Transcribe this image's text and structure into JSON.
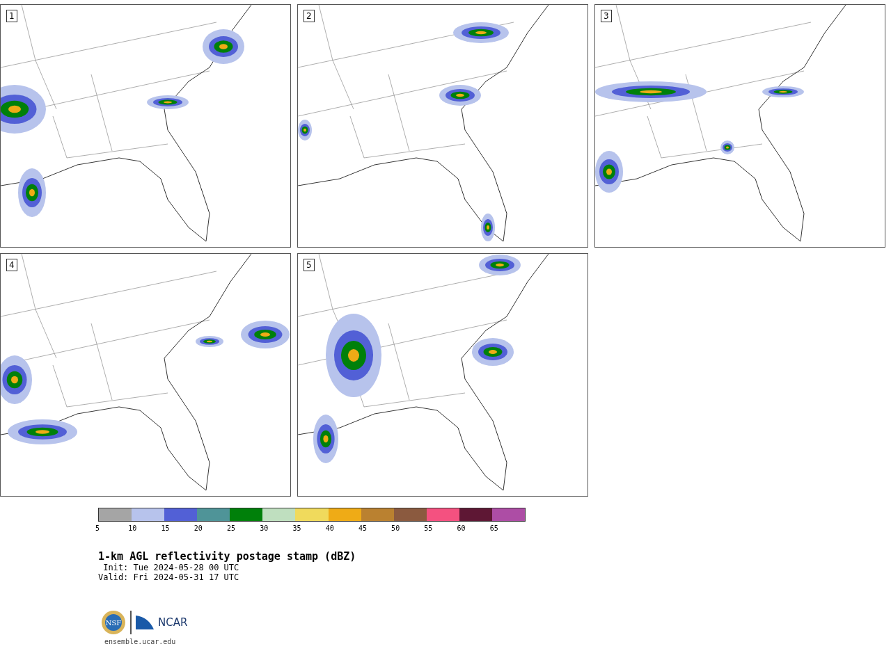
{
  "panels": [
    {
      "number": "1"
    },
    {
      "number": "2"
    },
    {
      "number": "3"
    },
    {
      "number": "4"
    },
    {
      "number": "5"
    }
  ],
  "colorbar": {
    "bins": [
      {
        "label": "5",
        "color": "#a5a5a5"
      },
      {
        "label": "10",
        "color": "#b7c3ec"
      },
      {
        "label": "15",
        "color": "#5260d6"
      },
      {
        "label": "20",
        "color": "#4f9498"
      },
      {
        "label": "25",
        "color": "#00800a"
      },
      {
        "label": "30",
        "color": "#bfdfbf"
      },
      {
        "label": "35",
        "color": "#f0da5c"
      },
      {
        "label": "40",
        "color": "#efab16"
      },
      {
        "label": "45",
        "color": "#ba8130"
      },
      {
        "label": "50",
        "color": "#8b5a3f"
      },
      {
        "label": "55",
        "color": "#f45180"
      },
      {
        "label": "60",
        "color": "#5e1734"
      },
      {
        "label": "65",
        "color": "#ad4da5"
      }
    ]
  },
  "title": "1-km AGL reflectivity postage stamp (dBZ)",
  "init": " Init: Tue 2024-05-28 00 UTC",
  "valid": "Valid: Fri 2024-05-31 17 UTC",
  "logo": {
    "left": "NSF",
    "right": "NCAR"
  },
  "site": "ensemble.ucar.edu"
}
